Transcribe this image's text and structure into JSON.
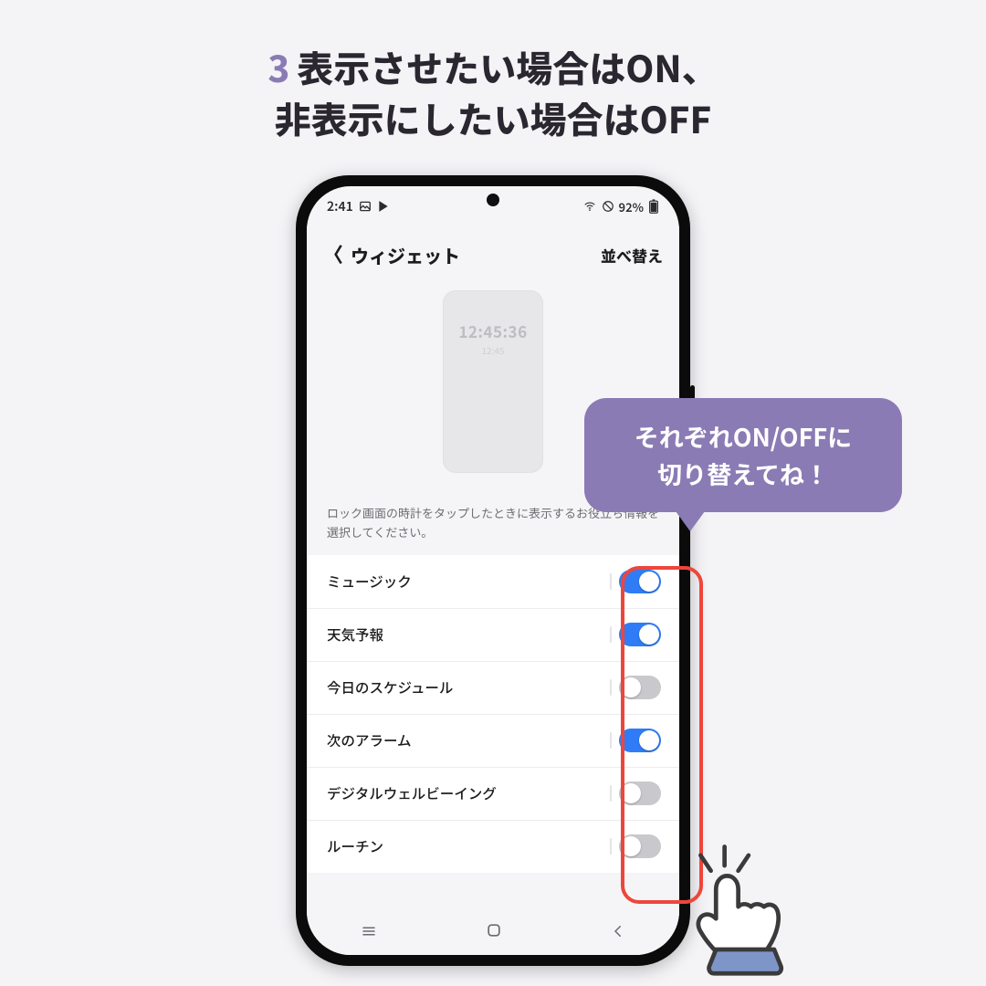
{
  "heading": {
    "step": "3",
    "line1": "表示させたい場合はON、",
    "line2": "非表示にしたい場合はOFF"
  },
  "statusbar": {
    "time": "2:41",
    "battery": "92%"
  },
  "titlebar": {
    "title": "ウィジェット",
    "sort": "並べ替え"
  },
  "preview": {
    "clock": "12:45:36",
    "sub": "12:45"
  },
  "description": "ロック画面の時計をタップしたときに表示するお役立ち情報を選択してください。",
  "items": [
    {
      "label": "ミュージック",
      "on": true
    },
    {
      "label": "天気予報",
      "on": true
    },
    {
      "label": "今日のスケジュール",
      "on": false
    },
    {
      "label": "次のアラーム",
      "on": true
    },
    {
      "label": "デジタルウェルビーイング",
      "on": false
    },
    {
      "label": "ルーチン",
      "on": false
    }
  ],
  "bubble": {
    "line1": "それぞれON/OFFに",
    "line2": "切り替えてね！"
  }
}
